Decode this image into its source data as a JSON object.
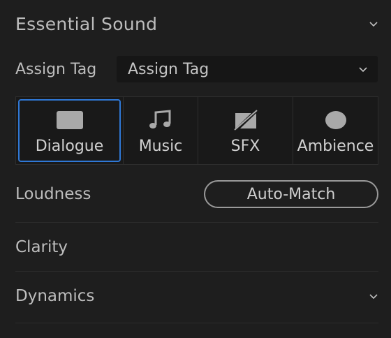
{
  "panel": {
    "title": "Essential Sound"
  },
  "assign_tag": {
    "label": "Assign Tag",
    "selected": "Assign Tag"
  },
  "tags": [
    {
      "label": "Dialogue",
      "icon": "dialogue-icon",
      "active": true
    },
    {
      "label": "Music",
      "icon": "music-note-icon",
      "active": false
    },
    {
      "label": "SFX",
      "icon": "sfx-icon",
      "active": false
    },
    {
      "label": "Ambience",
      "icon": "ambience-icon",
      "active": false
    }
  ],
  "loudness": {
    "label": "Loudness",
    "button_label": "Auto-Match"
  },
  "sections": {
    "clarity": "Clarity",
    "dynamics": "Dynamics"
  },
  "colors": {
    "background": "#1e1e1e",
    "accent": "#2f78d6",
    "text": "#bdbdbd"
  }
}
